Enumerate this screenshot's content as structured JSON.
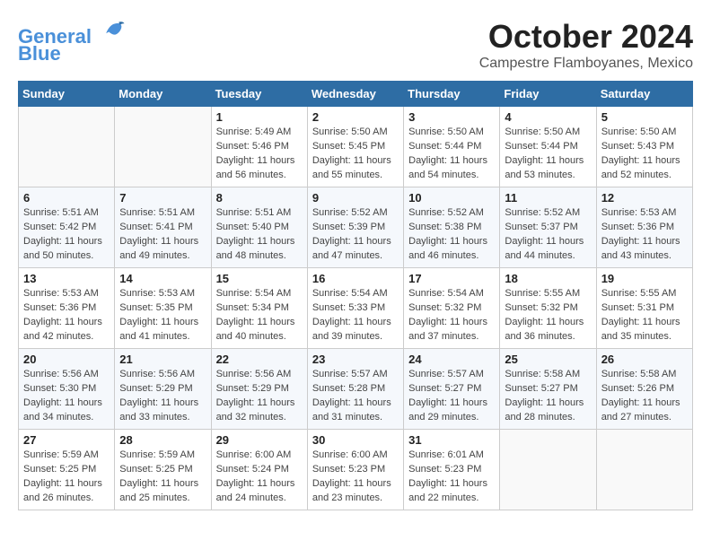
{
  "logo": {
    "line1": "General",
    "line2": "Blue"
  },
  "title": "October 2024",
  "location": "Campestre Flamboyanes, Mexico",
  "weekdays": [
    "Sunday",
    "Monday",
    "Tuesday",
    "Wednesday",
    "Thursday",
    "Friday",
    "Saturday"
  ],
  "weeks": [
    [
      {
        "day": "",
        "info": ""
      },
      {
        "day": "",
        "info": ""
      },
      {
        "day": "1",
        "info": "Sunrise: 5:49 AM\nSunset: 5:46 PM\nDaylight: 11 hours and 56 minutes."
      },
      {
        "day": "2",
        "info": "Sunrise: 5:50 AM\nSunset: 5:45 PM\nDaylight: 11 hours and 55 minutes."
      },
      {
        "day": "3",
        "info": "Sunrise: 5:50 AM\nSunset: 5:44 PM\nDaylight: 11 hours and 54 minutes."
      },
      {
        "day": "4",
        "info": "Sunrise: 5:50 AM\nSunset: 5:44 PM\nDaylight: 11 hours and 53 minutes."
      },
      {
        "day": "5",
        "info": "Sunrise: 5:50 AM\nSunset: 5:43 PM\nDaylight: 11 hours and 52 minutes."
      }
    ],
    [
      {
        "day": "6",
        "info": "Sunrise: 5:51 AM\nSunset: 5:42 PM\nDaylight: 11 hours and 50 minutes."
      },
      {
        "day": "7",
        "info": "Sunrise: 5:51 AM\nSunset: 5:41 PM\nDaylight: 11 hours and 49 minutes."
      },
      {
        "day": "8",
        "info": "Sunrise: 5:51 AM\nSunset: 5:40 PM\nDaylight: 11 hours and 48 minutes."
      },
      {
        "day": "9",
        "info": "Sunrise: 5:52 AM\nSunset: 5:39 PM\nDaylight: 11 hours and 47 minutes."
      },
      {
        "day": "10",
        "info": "Sunrise: 5:52 AM\nSunset: 5:38 PM\nDaylight: 11 hours and 46 minutes."
      },
      {
        "day": "11",
        "info": "Sunrise: 5:52 AM\nSunset: 5:37 PM\nDaylight: 11 hours and 44 minutes."
      },
      {
        "day": "12",
        "info": "Sunrise: 5:53 AM\nSunset: 5:36 PM\nDaylight: 11 hours and 43 minutes."
      }
    ],
    [
      {
        "day": "13",
        "info": "Sunrise: 5:53 AM\nSunset: 5:36 PM\nDaylight: 11 hours and 42 minutes."
      },
      {
        "day": "14",
        "info": "Sunrise: 5:53 AM\nSunset: 5:35 PM\nDaylight: 11 hours and 41 minutes."
      },
      {
        "day": "15",
        "info": "Sunrise: 5:54 AM\nSunset: 5:34 PM\nDaylight: 11 hours and 40 minutes."
      },
      {
        "day": "16",
        "info": "Sunrise: 5:54 AM\nSunset: 5:33 PM\nDaylight: 11 hours and 39 minutes."
      },
      {
        "day": "17",
        "info": "Sunrise: 5:54 AM\nSunset: 5:32 PM\nDaylight: 11 hours and 37 minutes."
      },
      {
        "day": "18",
        "info": "Sunrise: 5:55 AM\nSunset: 5:32 PM\nDaylight: 11 hours and 36 minutes."
      },
      {
        "day": "19",
        "info": "Sunrise: 5:55 AM\nSunset: 5:31 PM\nDaylight: 11 hours and 35 minutes."
      }
    ],
    [
      {
        "day": "20",
        "info": "Sunrise: 5:56 AM\nSunset: 5:30 PM\nDaylight: 11 hours and 34 minutes."
      },
      {
        "day": "21",
        "info": "Sunrise: 5:56 AM\nSunset: 5:29 PM\nDaylight: 11 hours and 33 minutes."
      },
      {
        "day": "22",
        "info": "Sunrise: 5:56 AM\nSunset: 5:29 PM\nDaylight: 11 hours and 32 minutes."
      },
      {
        "day": "23",
        "info": "Sunrise: 5:57 AM\nSunset: 5:28 PM\nDaylight: 11 hours and 31 minutes."
      },
      {
        "day": "24",
        "info": "Sunrise: 5:57 AM\nSunset: 5:27 PM\nDaylight: 11 hours and 29 minutes."
      },
      {
        "day": "25",
        "info": "Sunrise: 5:58 AM\nSunset: 5:27 PM\nDaylight: 11 hours and 28 minutes."
      },
      {
        "day": "26",
        "info": "Sunrise: 5:58 AM\nSunset: 5:26 PM\nDaylight: 11 hours and 27 minutes."
      }
    ],
    [
      {
        "day": "27",
        "info": "Sunrise: 5:59 AM\nSunset: 5:25 PM\nDaylight: 11 hours and 26 minutes."
      },
      {
        "day": "28",
        "info": "Sunrise: 5:59 AM\nSunset: 5:25 PM\nDaylight: 11 hours and 25 minutes."
      },
      {
        "day": "29",
        "info": "Sunrise: 6:00 AM\nSunset: 5:24 PM\nDaylight: 11 hours and 24 minutes."
      },
      {
        "day": "30",
        "info": "Sunrise: 6:00 AM\nSunset: 5:23 PM\nDaylight: 11 hours and 23 minutes."
      },
      {
        "day": "31",
        "info": "Sunrise: 6:01 AM\nSunset: 5:23 PM\nDaylight: 11 hours and 22 minutes."
      },
      {
        "day": "",
        "info": ""
      },
      {
        "day": "",
        "info": ""
      }
    ]
  ]
}
